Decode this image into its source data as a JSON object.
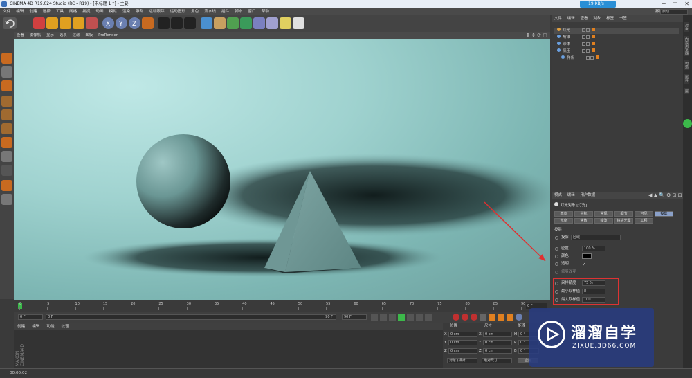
{
  "window": {
    "title": "CINEMA 4D R19.024 Studio (RC - R19) - [未标题 1 *] - 主要",
    "net_badge": "19 KB/s"
  },
  "menu": [
    "文件",
    "编辑",
    "创建",
    "选择",
    "工具",
    "网格",
    "捕捉",
    "动画",
    "模拟",
    "渲染",
    "雕刻",
    "运动跟踪",
    "运动图形",
    "角色",
    "流水线",
    "插件",
    "脚本",
    "窗口",
    "帮助"
  ],
  "layout": {
    "label": "界面:",
    "value": "启动"
  },
  "viewport_menu": [
    "查看",
    "摄像机",
    "显示",
    "选项",
    "过滤",
    "面板",
    "ProRender"
  ],
  "timeline": {
    "ticks": [
      "0",
      "5",
      "10",
      "15",
      "20",
      "25",
      "30",
      "35",
      "40",
      "45",
      "50",
      "55",
      "60",
      "65",
      "70",
      "75",
      "80",
      "85",
      "90"
    ],
    "end_label": "0 F"
  },
  "transport": {
    "start": "0 F",
    "current": "0 F",
    "end": "90 F",
    "end2": "90 F"
  },
  "material_tabs": [
    "创建",
    "编辑",
    "功能",
    "纹理"
  ],
  "coords": {
    "headers": [
      "位置",
      "尺寸",
      "旋转"
    ],
    "rows": [
      {
        "axis": "X",
        "pos": "0 cm",
        "size_axis": "X",
        "size": "0 cm",
        "rot_axis": "H",
        "rot": "0 °"
      },
      {
        "axis": "Y",
        "pos": "0 cm",
        "size_axis": "Y",
        "size": "0 cm",
        "rot_axis": "P",
        "rot": "0 °"
      },
      {
        "axis": "Z",
        "pos": "0 cm",
        "size_axis": "Z",
        "size": "0 cm",
        "rot_axis": "B",
        "rot": "0 °"
      }
    ],
    "mode": "对象 (相对)",
    "mode2": "绝对尺寸",
    "apply": "应用"
  },
  "status": "00:00:02",
  "object_manager": {
    "tabs": [
      "文件",
      "编辑",
      "查看",
      "对象",
      "标签",
      "书签"
    ],
    "objects": [
      {
        "name": "灯光",
        "color": "#e0a040"
      },
      {
        "name": "角锥",
        "color": "#6aa0e0"
      },
      {
        "name": "球体",
        "color": "#6aa0e0"
      },
      {
        "name": "挤压",
        "color": "#6aa0e0"
      },
      {
        "name": "样条",
        "color": "#6aa0e0"
      }
    ]
  },
  "attribute_manager": {
    "tabs": [
      "模式",
      "编辑",
      "用户数据"
    ],
    "object_title": "灯光对象 [灯光]",
    "buttons_row1": [
      "基本",
      "坐标",
      "常规",
      "细节",
      "可见",
      "投影"
    ],
    "buttons_row2": [
      "光度",
      "焦散",
      "噪波",
      "镜头光晕",
      "工程"
    ],
    "section": "投影",
    "shadow_label": "投影",
    "shadow_value": "区域",
    "density_label": "密度",
    "density_value": "100 %",
    "color_label": "颜色",
    "transparency_label": "透明",
    "clip_label": "修剪改变",
    "sampling_label": "采样精度",
    "sampling_value": "75 %",
    "min_samples_label": "最小取样值",
    "min_samples_value": "8",
    "max_samples_label": "最大取样值",
    "max_samples_value": "100"
  },
  "right_edge_tabs": [
    "对象",
    "内容浏览器",
    "构造",
    "属性",
    "层"
  ],
  "watermark": {
    "title": "溜溜自学",
    "url": "ZIXUE.3D66.COM"
  }
}
